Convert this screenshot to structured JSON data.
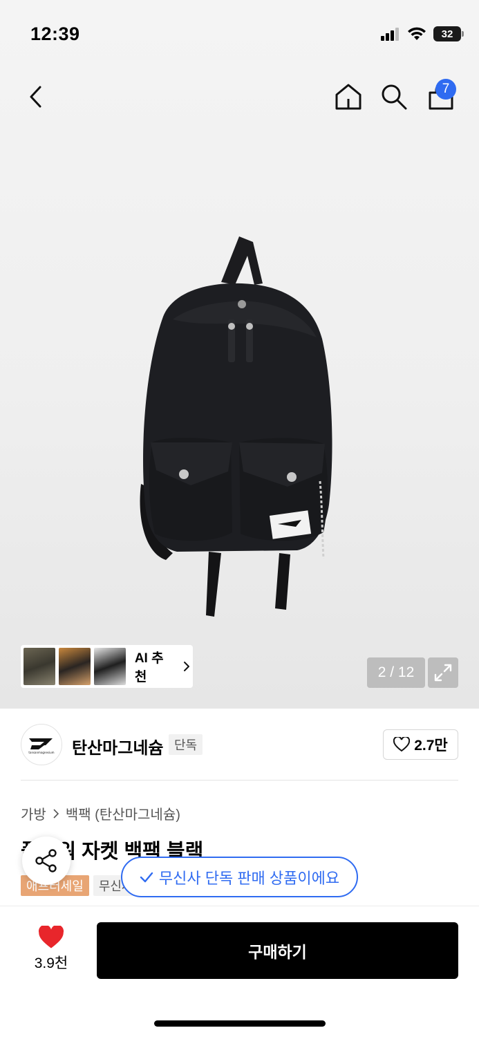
{
  "status_bar": {
    "time": "12:39",
    "battery": "32"
  },
  "nav": {
    "cart_count": "7"
  },
  "gallery": {
    "counter": "2 / 12",
    "ai_label": "AI 추천"
  },
  "brand": {
    "logo_text": "tansanmagnesium",
    "name": "탄산마그네슘",
    "tag": "단독",
    "likes": "2.7만"
  },
  "breadcrumb": {
    "category": "가방",
    "separator": ">",
    "subcategory": "백팩 (탄산마그네슘)"
  },
  "product": {
    "title": "플라워 자켓 백팩 블랙",
    "tags": [
      "애프터세일",
      "무신사"
    ]
  },
  "toast": {
    "text": "무신사 단독 판매 상품이에요"
  },
  "bottom": {
    "likes": "3.9천",
    "buy_label": "구매하기"
  },
  "colors": {
    "accent": "#2f6bf1",
    "like_red": "#e8262b",
    "sale_tag": "#e8a574"
  },
  "icons": [
    "back-icon",
    "home-icon",
    "search-icon",
    "cart-icon",
    "chevron-right-icon",
    "expand-icon",
    "heart-icon",
    "share-icon",
    "check-icon"
  ]
}
